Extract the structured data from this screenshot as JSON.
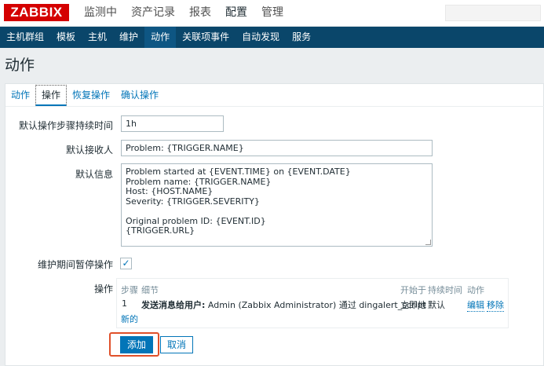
{
  "logo": "ZABBIX",
  "topmenu": [
    "监测中",
    "资产记录",
    "报表",
    "配置",
    "管理"
  ],
  "subnav": [
    "主机群组",
    "模板",
    "主机",
    "维护",
    "动作",
    "关联项事件",
    "自动发现",
    "服务"
  ],
  "page_title": "动作",
  "tabs": [
    "动作",
    "操作",
    "恢复操作",
    "确认操作"
  ],
  "form": {
    "step_duration_label": "默认操作步骤持续时间",
    "step_duration_value": "1h",
    "subject_label": "默认接收人",
    "subject_value": "Problem: {TRIGGER.NAME}",
    "message_label": "默认信息",
    "message_value": "Problem started at {EVENT.TIME} on {EVENT.DATE}\nProblem name: {TRIGGER.NAME}\nHost: {HOST.NAME}\nSeverity: {TRIGGER.SEVERITY}\n\nOriginal problem ID: {EVENT.ID}\n{TRIGGER.URL}",
    "pause_label": "维护期间暂停操作",
    "pause_checked": "✓",
    "operations_label": "操作"
  },
  "operations": {
    "headers": {
      "steps": "步骤",
      "details": "细节",
      "start_in": "开始于",
      "duration": "持续时间",
      "action": "动作"
    },
    "row": {
      "step": "1",
      "detail_bold": "发送消息给用户:",
      "detail_rest": " Admin (Zabbix Administrator) 通过 dingalert_script",
      "start_in": "立即地",
      "duration": "默认",
      "edit": "编辑",
      "remove": "移除"
    },
    "new_link": "新的"
  },
  "buttons": {
    "add": "添加",
    "cancel": "取消"
  }
}
